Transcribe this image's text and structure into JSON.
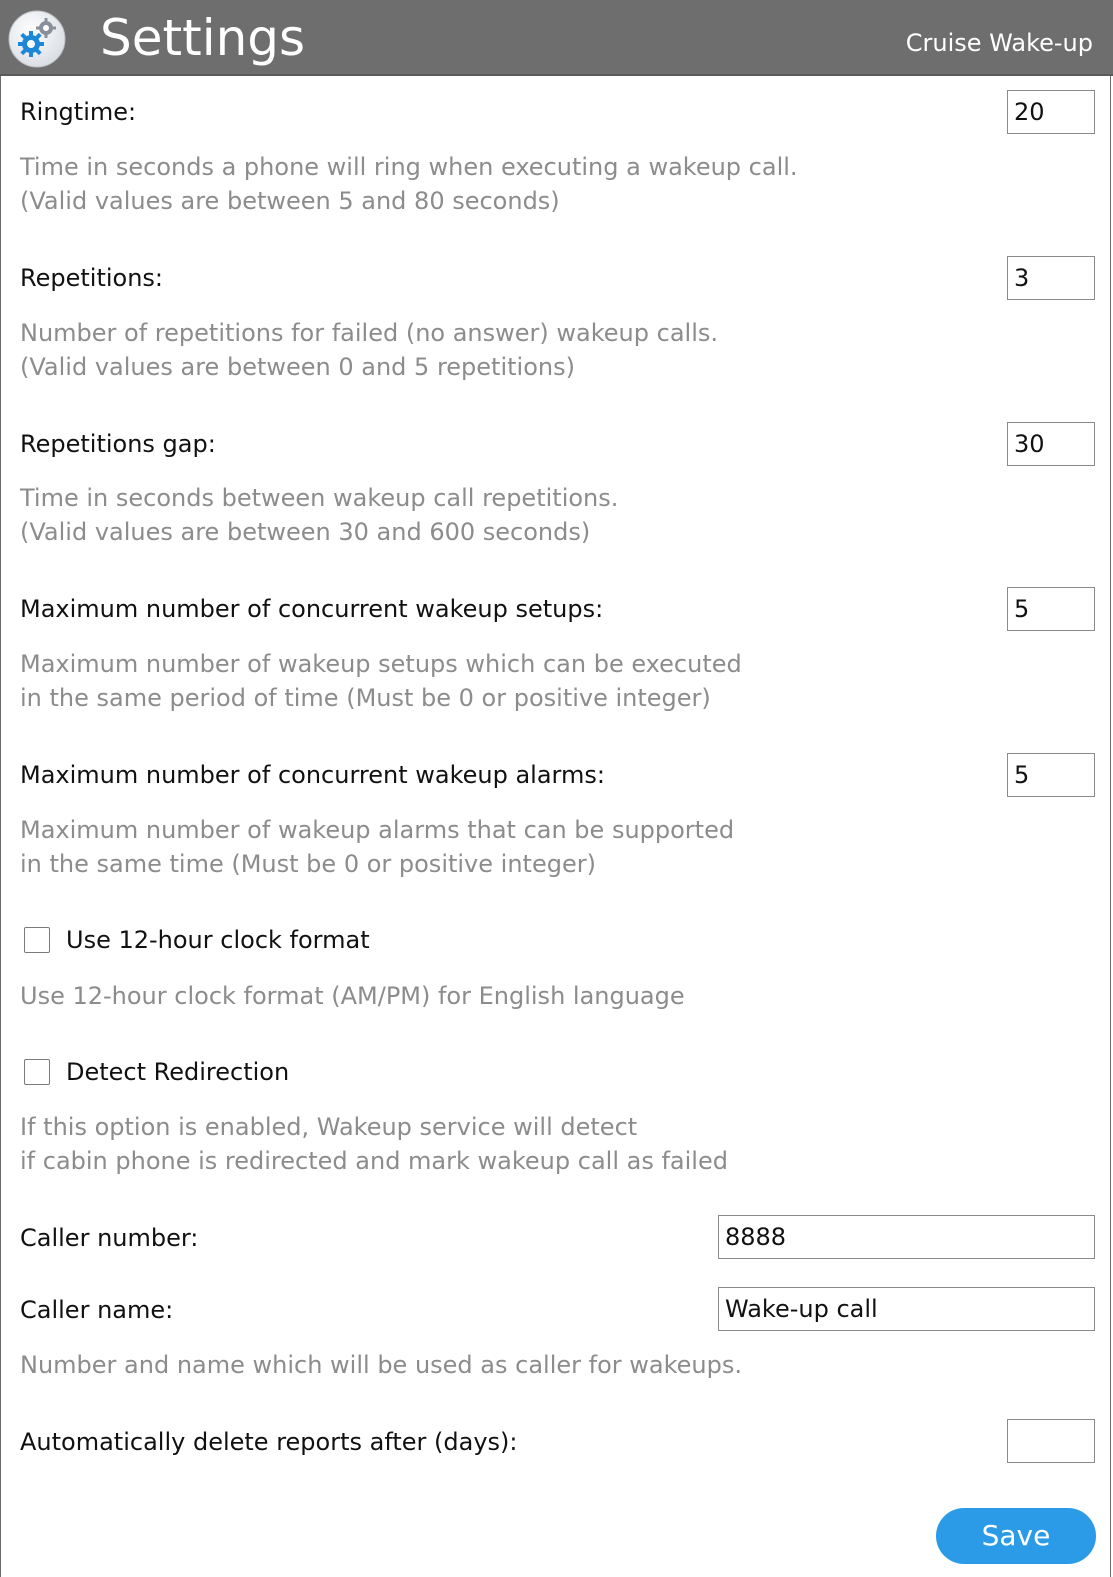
{
  "header": {
    "title": "Settings",
    "app_name": "Cruise Wake-up",
    "logo_icon": "gears-icon"
  },
  "ringtime": {
    "label": "Ringtime:",
    "value": "20",
    "description": "Time in seconds a phone will ring when executing a wakeup call.\n(Valid values are between 5 and 80 seconds)"
  },
  "repetitions": {
    "label": "Repetitions:",
    "value": "3",
    "description": "Number of repetitions for failed (no answer) wakeup calls.\n(Valid values are between 0 and 5 repetitions)"
  },
  "repetitions_gap": {
    "label": "Repetitions gap:",
    "value": "30",
    "description": "Time in seconds between wakeup call repetitions.\n(Valid values are between 30 and 600 seconds)"
  },
  "max_setups": {
    "label": "Maximum number of concurrent wakeup setups:",
    "value": "5",
    "description": "Maximum number of wakeup setups which can be executed\nin the same period of time (Must be 0 or positive integer)"
  },
  "max_alarms": {
    "label": "Maximum number of concurrent wakeup alarms:",
    "value": "5",
    "description": "Maximum number of wakeup alarms that can be supported\nin the same time (Must be 0 or positive integer)"
  },
  "clock_format": {
    "label": "Use 12-hour clock format",
    "checked": false,
    "description": "Use 12-hour clock format (AM/PM) for English language"
  },
  "detect_redirection": {
    "label": "Detect Redirection",
    "checked": false,
    "description": "If this option is enabled, Wakeup service will detect\nif cabin phone is redirected and mark wakeup call as failed"
  },
  "caller": {
    "number_label": "Caller number:",
    "number_value": "8888",
    "name_label": "Caller name:",
    "name_value": "Wake-up call",
    "description": "Number and name which will be used as caller for wakeups."
  },
  "auto_delete": {
    "label": "Automatically delete reports after (days):",
    "value": ""
  },
  "save_button": {
    "label": "Save"
  },
  "colors": {
    "header_bg": "#6e6e6e",
    "description_text": "#8c8c8c",
    "save_button_bg": "#2b9be8"
  }
}
